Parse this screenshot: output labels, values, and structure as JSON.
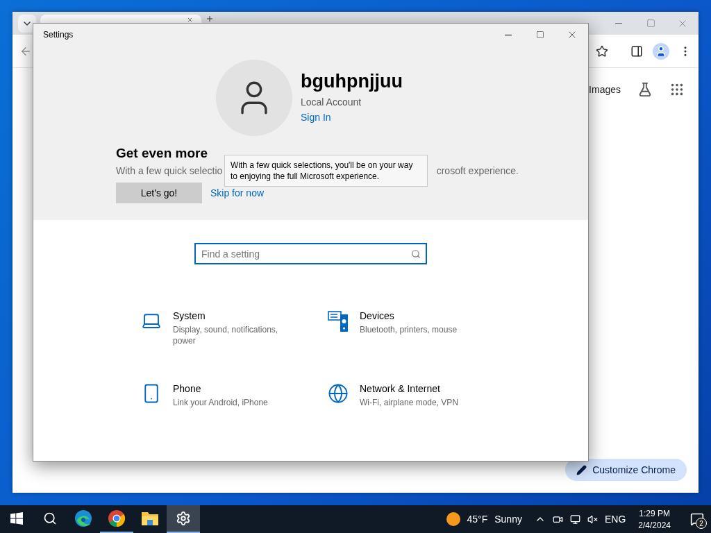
{
  "browser": {
    "link": "Images",
    "customize_button": "Customize Chrome"
  },
  "settings": {
    "title": "Settings",
    "account": {
      "name": "bguhpnjjuu",
      "type": "Local Account",
      "sign_in": "Sign In"
    },
    "banner": {
      "heading": "Get even more",
      "text_parts": [
        "With a few quick selectio",
        "crosoft experience."
      ],
      "primary_button": "Let's go!",
      "secondary_link": "Skip for now"
    },
    "tooltip": "With a few quick selections, you'll be on your way to enjoying the full Microsoft experience.",
    "search": {
      "placeholder": "Find a setting",
      "focused": true
    },
    "categories": [
      {
        "kind": "laptop",
        "title": "System",
        "description": "Display, sound, notifications, power"
      },
      {
        "kind": "devices",
        "title": "Devices",
        "description": "Bluetooth, printers, mouse"
      },
      {
        "kind": "phone",
        "title": "Phone",
        "description": "Link your Android, iPhone"
      },
      {
        "kind": "globe",
        "title": "Network & Internet",
        "description": "Wi-Fi, airplane mode, VPN"
      }
    ]
  },
  "taskbar": {
    "apps": [
      {
        "kind": "start",
        "selected": false,
        "running": false
      },
      {
        "kind": "search",
        "selected": false,
        "running": false
      },
      {
        "kind": "edge",
        "selected": false,
        "running": false
      },
      {
        "kind": "chrome",
        "selected": false,
        "running": true
      },
      {
        "kind": "folder",
        "selected": false,
        "running": false
      },
      {
        "kind": "settings",
        "selected": true,
        "running": true
      }
    ],
    "weather": {
      "temperature": "45°F",
      "condition": "Sunny"
    },
    "language": "ENG",
    "time": "1:29 PM",
    "date": "2/4/2024",
    "notifications": "2"
  }
}
